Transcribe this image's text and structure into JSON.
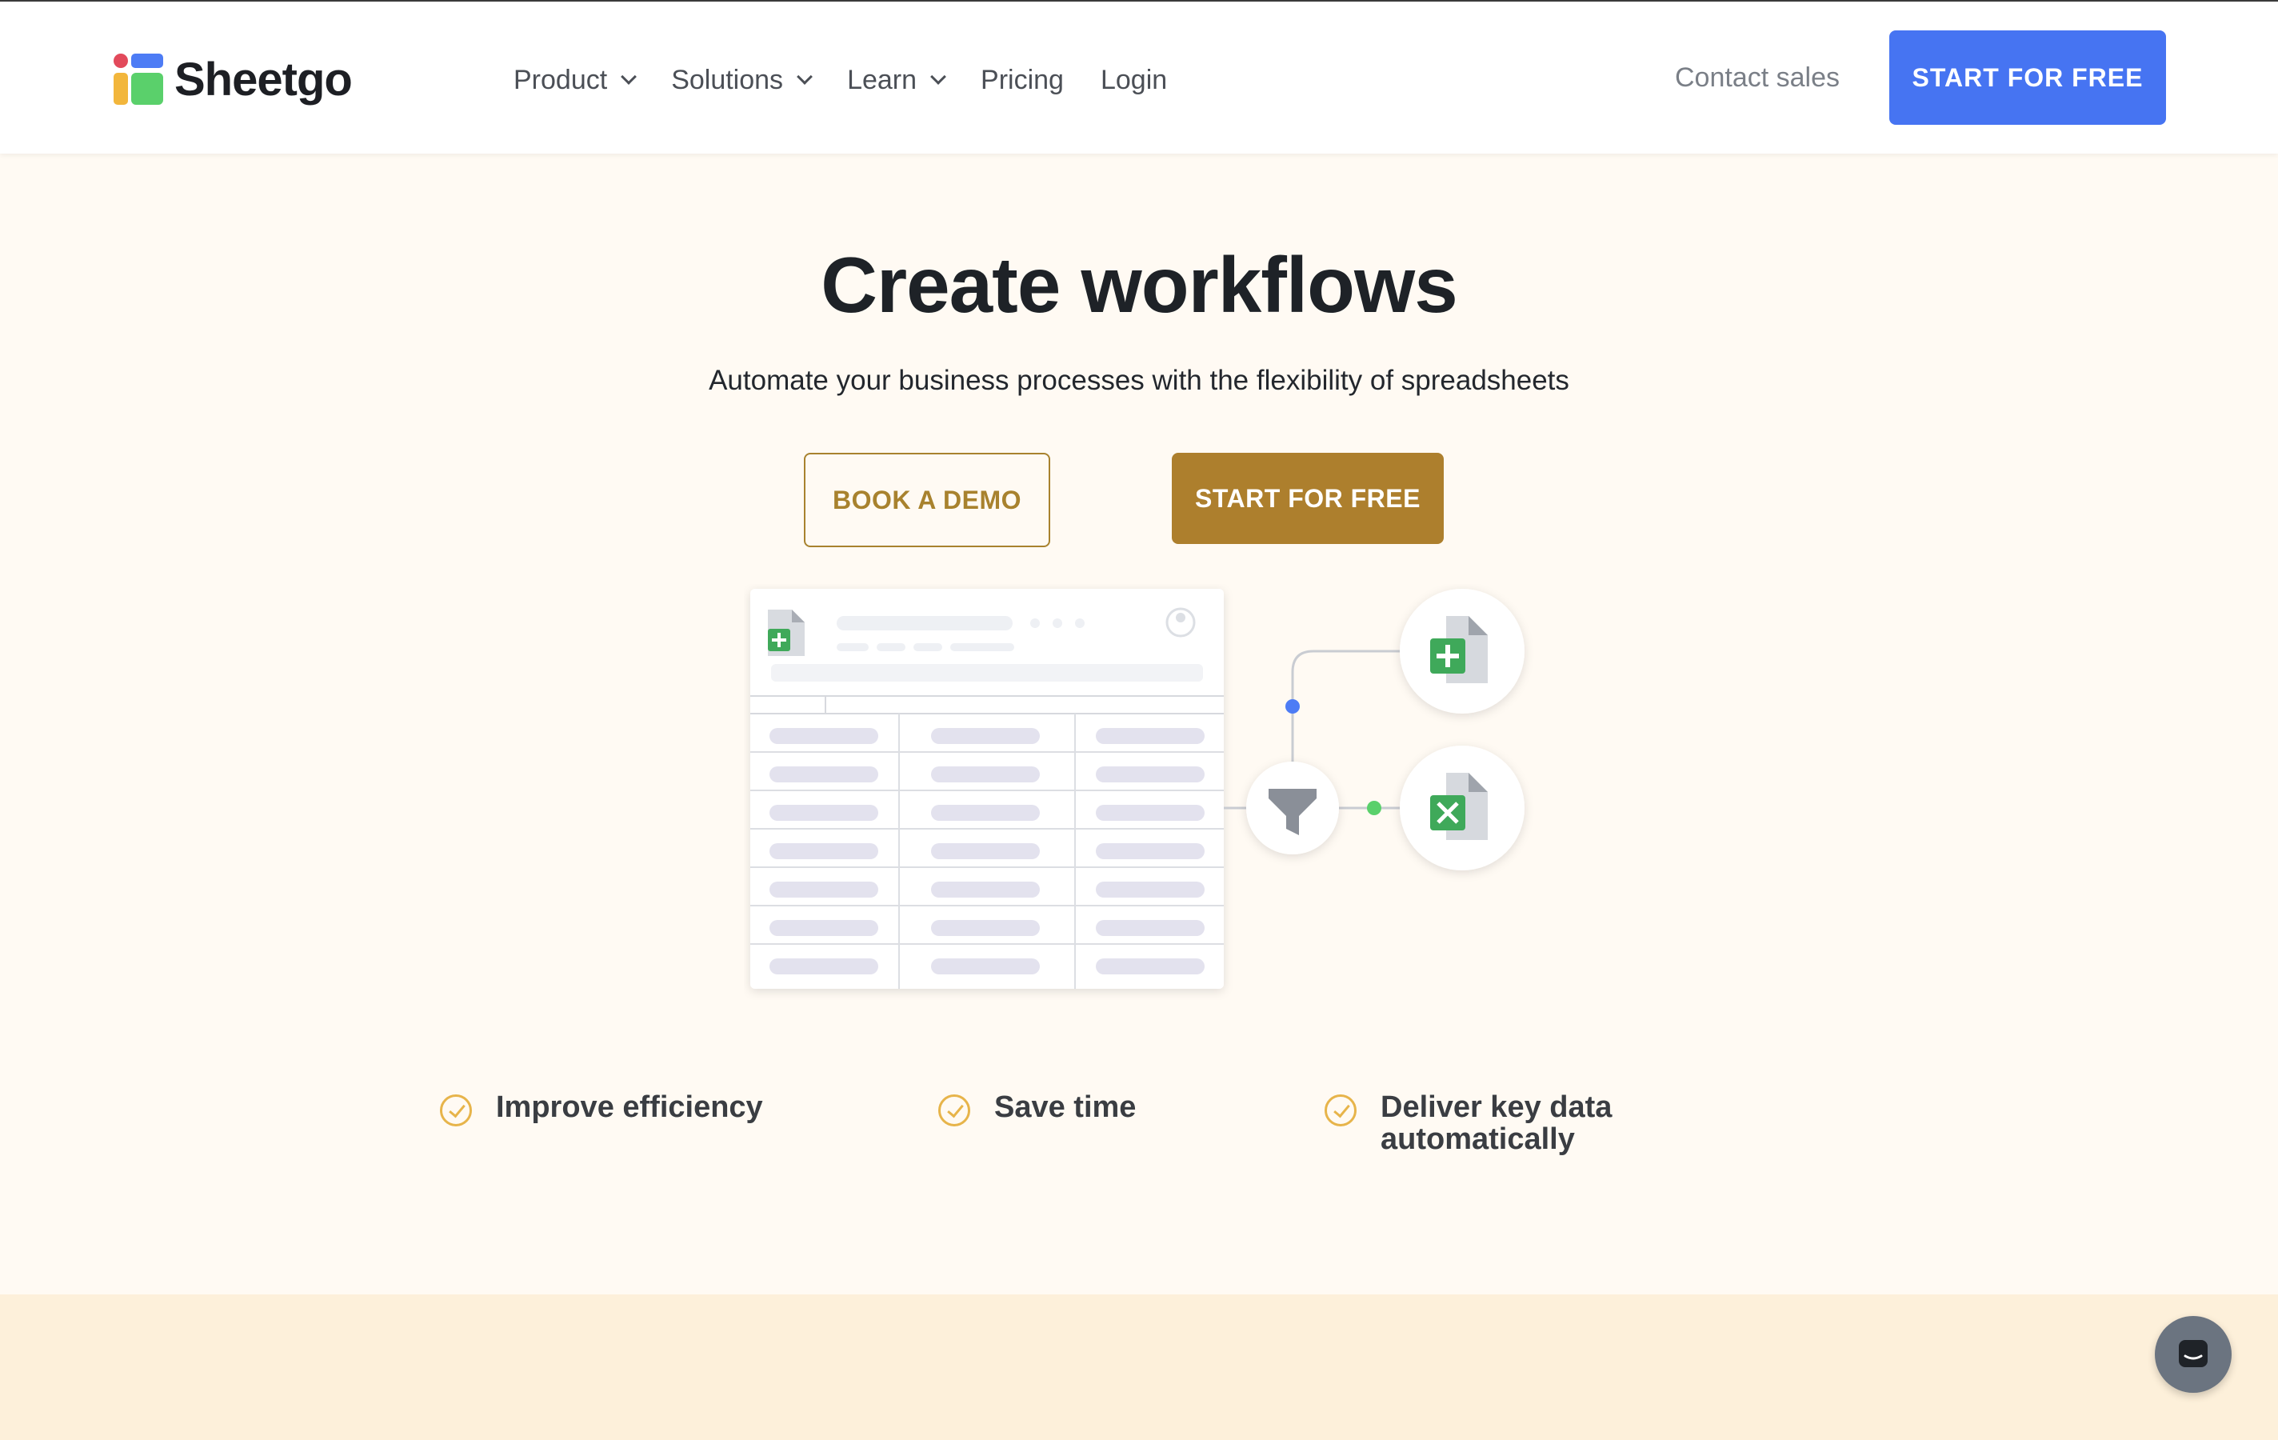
{
  "brand": {
    "name": "Sheetgo"
  },
  "nav": {
    "items": [
      {
        "label": "Product",
        "dropdown": true
      },
      {
        "label": "Solutions",
        "dropdown": true
      },
      {
        "label": "Learn",
        "dropdown": true
      },
      {
        "label": "Pricing",
        "dropdown": false
      },
      {
        "label": "Login",
        "dropdown": false
      }
    ],
    "contact_label": "Contact sales",
    "cta_label": "START FOR FREE"
  },
  "hero": {
    "title": "Create workflows",
    "subtitle": "Automate your business processes with the flexibility of spreadsheets",
    "demo_label": "BOOK A DEMO",
    "start_label": "START FOR FREE"
  },
  "features": [
    {
      "label": "Improve efficiency"
    },
    {
      "label": "Save time"
    },
    {
      "label": "Deliver key data automatically"
    }
  ],
  "colors": {
    "primary_blue": "#4674f2",
    "gold": "#ad7f2d",
    "check_yellow": "#e7b44a",
    "hero_bg": "#fffaf3",
    "band_bg": "#fdf0da"
  },
  "icons": {
    "chat": "chat-icon",
    "filter": "filter-icon",
    "sheets": "google-sheets-icon",
    "excel": "excel-icon"
  }
}
